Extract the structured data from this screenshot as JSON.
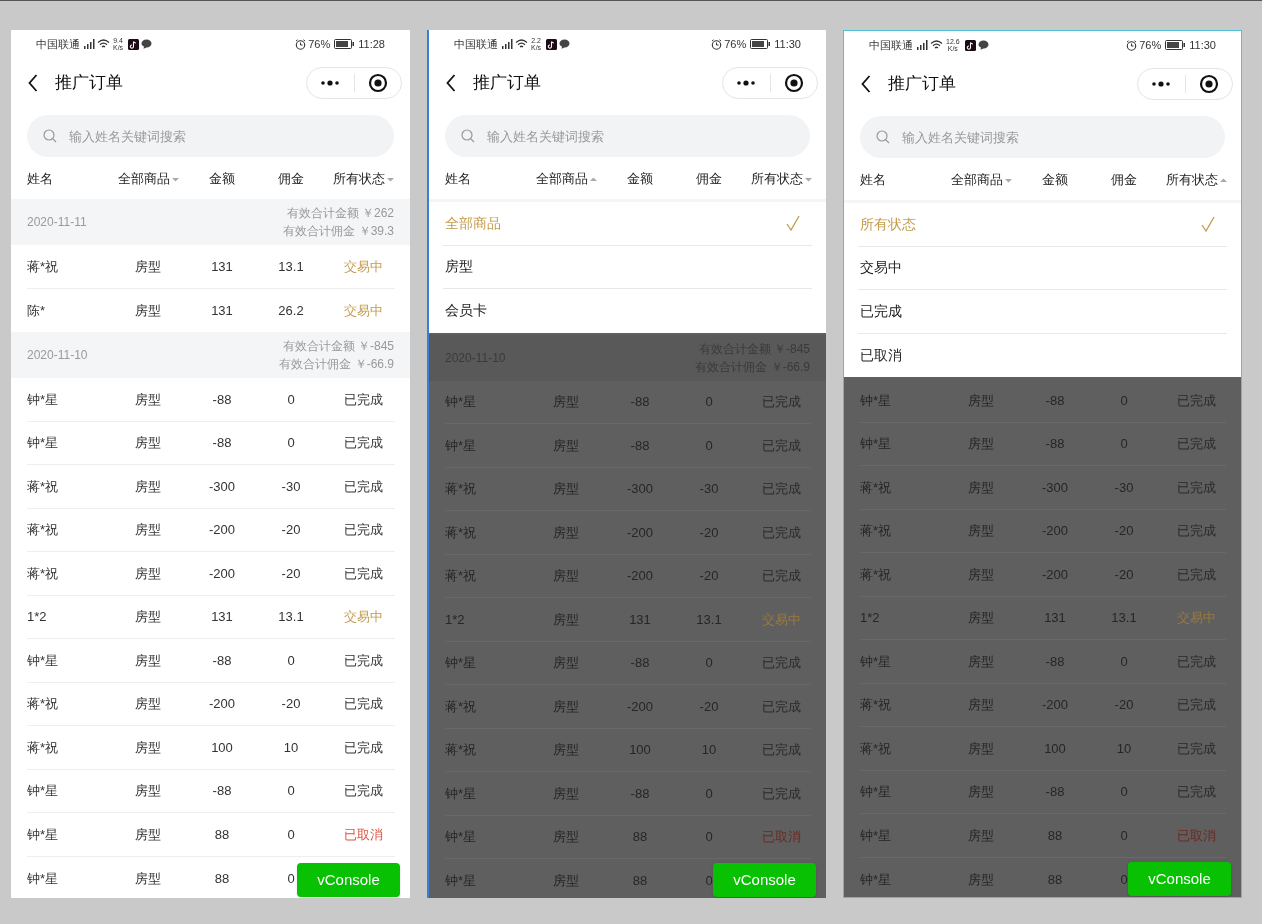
{
  "phones": [
    {
      "status_bar": {
        "carrier": "中国联通",
        "speed": "9.4",
        "speed_unit": "K/s",
        "battery": "76%",
        "time": "11:28"
      },
      "title": "推广订单",
      "search": {
        "placeholder": "输入姓名关键词搜索"
      },
      "columns": [
        {
          "label": "姓名",
          "kind": "label"
        },
        {
          "label": "全部商品",
          "kind": "filter",
          "expanded": false
        },
        {
          "label": "金额",
          "kind": "label"
        },
        {
          "label": "佣金",
          "kind": "label"
        },
        {
          "label": "所有状态",
          "kind": "filter",
          "expanded": false
        }
      ],
      "dimmed": false,
      "groups": [
        {
          "date": "2020-11-11",
          "total_amount": "有效合计金额 ￥262",
          "total_commission": "有效合计佣金 ￥39.3",
          "rows": [
            {
              "name": "蒋*祝",
              "product": "房型",
              "amount": "131",
              "commission": "13.1",
              "status": "交易中",
              "kind": "trading"
            },
            {
              "name": "陈*",
              "product": "房型",
              "amount": "131",
              "commission": "26.2",
              "status": "交易中",
              "kind": "trading"
            }
          ]
        },
        {
          "date": "2020-11-10",
          "total_amount": "有效合计金额 ￥-845",
          "total_commission": "有效合计佣金 ￥-66.9",
          "rows": [
            {
              "name": "钟*星",
              "product": "房型",
              "amount": "-88",
              "commission": "0",
              "status": "已完成",
              "kind": "done"
            },
            {
              "name": "钟*星",
              "product": "房型",
              "amount": "-88",
              "commission": "0",
              "status": "已完成",
              "kind": "done"
            },
            {
              "name": "蒋*祝",
              "product": "房型",
              "amount": "-300",
              "commission": "-30",
              "status": "已完成",
              "kind": "done"
            },
            {
              "name": "蒋*祝",
              "product": "房型",
              "amount": "-200",
              "commission": "-20",
              "status": "已完成",
              "kind": "done"
            },
            {
              "name": "蒋*祝",
              "product": "房型",
              "amount": "-200",
              "commission": "-20",
              "status": "已完成",
              "kind": "done"
            },
            {
              "name": "1*2",
              "product": "房型",
              "amount": "131",
              "commission": "13.1",
              "status": "交易中",
              "kind": "trading"
            },
            {
              "name": "钟*星",
              "product": "房型",
              "amount": "-88",
              "commission": "0",
              "status": "已完成",
              "kind": "done"
            },
            {
              "name": "蒋*祝",
              "product": "房型",
              "amount": "-200",
              "commission": "-20",
              "status": "已完成",
              "kind": "done"
            },
            {
              "name": "蒋*祝",
              "product": "房型",
              "amount": "100",
              "commission": "10",
              "status": "已完成",
              "kind": "done"
            },
            {
              "name": "钟*星",
              "product": "房型",
              "amount": "-88",
              "commission": "0",
              "status": "已完成",
              "kind": "done"
            },
            {
              "name": "钟*星",
              "product": "房型",
              "amount": "88",
              "commission": "0",
              "status": "已取消",
              "kind": "cancelled"
            },
            {
              "name": "钟*星",
              "product": "房型",
              "amount": "88",
              "commission": "0"
            }
          ]
        }
      ],
      "vconsole": "vConsole"
    },
    {
      "status_bar": {
        "carrier": "中国联通",
        "speed": "2.2",
        "speed_unit": "K/s",
        "battery": "76%",
        "time": "11:30"
      },
      "title": "推广订单",
      "search": {
        "placeholder": "输入姓名关键词搜索"
      },
      "columns": [
        {
          "label": "姓名",
          "kind": "label"
        },
        {
          "label": "全部商品",
          "kind": "filter",
          "expanded": true
        },
        {
          "label": "金额",
          "kind": "label"
        },
        {
          "label": "佣金",
          "kind": "label"
        },
        {
          "label": "所有状态",
          "kind": "filter",
          "expanded": false
        }
      ],
      "menu": {
        "options": [
          {
            "label": "全部商品",
            "selected": true
          },
          {
            "label": "房型",
            "selected": false
          },
          {
            "label": "会员卡",
            "selected": false
          }
        ]
      },
      "dimmed": true,
      "groups": [
        {
          "date": "2020-11-10",
          "total_amount": "有效合计金额 ￥-845",
          "total_commission": "有效合计佣金 ￥-66.9",
          "rows": [
            {
              "name": "钟*星",
              "product": "房型",
              "amount": "-88",
              "commission": "0",
              "status": "已完成",
              "kind": "done"
            },
            {
              "name": "钟*星",
              "product": "房型",
              "amount": "-88",
              "commission": "0",
              "status": "已完成",
              "kind": "done"
            },
            {
              "name": "蒋*祝",
              "product": "房型",
              "amount": "-300",
              "commission": "-30",
              "status": "已完成",
              "kind": "done"
            },
            {
              "name": "蒋*祝",
              "product": "房型",
              "amount": "-200",
              "commission": "-20",
              "status": "已完成",
              "kind": "done"
            },
            {
              "name": "蒋*祝",
              "product": "房型",
              "amount": "-200",
              "commission": "-20",
              "status": "已完成",
              "kind": "done"
            },
            {
              "name": "1*2",
              "product": "房型",
              "amount": "131",
              "commission": "13.1",
              "status": "交易中",
              "kind": "trading"
            },
            {
              "name": "钟*星",
              "product": "房型",
              "amount": "-88",
              "commission": "0",
              "status": "已完成",
              "kind": "done"
            },
            {
              "name": "蒋*祝",
              "product": "房型",
              "amount": "-200",
              "commission": "-20",
              "status": "已完成",
              "kind": "done"
            },
            {
              "name": "蒋*祝",
              "product": "房型",
              "amount": "100",
              "commission": "10",
              "status": "已完成",
              "kind": "done"
            },
            {
              "name": "钟*星",
              "product": "房型",
              "amount": "-88",
              "commission": "0",
              "status": "已完成",
              "kind": "done"
            },
            {
              "name": "钟*星",
              "product": "房型",
              "amount": "88",
              "commission": "0",
              "status": "已取消",
              "kind": "cancelled"
            },
            {
              "name": "钟*星",
              "product": "房型",
              "amount": "88",
              "commission": "0"
            }
          ]
        }
      ],
      "vconsole": "vConsole"
    },
    {
      "status_bar": {
        "carrier": "中国联通",
        "speed": "12.6",
        "speed_unit": "K/s",
        "battery": "76%",
        "time": "11:30"
      },
      "title": "推广订单",
      "search": {
        "placeholder": "输入姓名关键词搜索"
      },
      "columns": [
        {
          "label": "姓名",
          "kind": "label"
        },
        {
          "label": "全部商品",
          "kind": "filter",
          "expanded": false
        },
        {
          "label": "金额",
          "kind": "label"
        },
        {
          "label": "佣金",
          "kind": "label"
        },
        {
          "label": "所有状态",
          "kind": "filter",
          "expanded": true
        }
      ],
      "menu": {
        "options": [
          {
            "label": "所有状态",
            "selected": true
          },
          {
            "label": "交易中",
            "selected": false
          },
          {
            "label": "已完成",
            "selected": false
          },
          {
            "label": "已取消",
            "selected": false
          }
        ]
      },
      "dimmed": true,
      "groups": [
        {
          "rows": [
            {
              "name": "钟*星",
              "product": "房型",
              "amount": "-88",
              "commission": "0",
              "status": "已完成",
              "kind": "done"
            },
            {
              "name": "钟*星",
              "product": "房型",
              "amount": "-88",
              "commission": "0",
              "status": "已完成",
              "kind": "done"
            },
            {
              "name": "蒋*祝",
              "product": "房型",
              "amount": "-300",
              "commission": "-30",
              "status": "已完成",
              "kind": "done"
            },
            {
              "name": "蒋*祝",
              "product": "房型",
              "amount": "-200",
              "commission": "-20",
              "status": "已完成",
              "kind": "done"
            },
            {
              "name": "蒋*祝",
              "product": "房型",
              "amount": "-200",
              "commission": "-20",
              "status": "已完成",
              "kind": "done"
            },
            {
              "name": "1*2",
              "product": "房型",
              "amount": "131",
              "commission": "13.1",
              "status": "交易中",
              "kind": "trading"
            },
            {
              "name": "钟*星",
              "product": "房型",
              "amount": "-88",
              "commission": "0",
              "status": "已完成",
              "kind": "done"
            },
            {
              "name": "蒋*祝",
              "product": "房型",
              "amount": "-200",
              "commission": "-20",
              "status": "已完成",
              "kind": "done"
            },
            {
              "name": "蒋*祝",
              "product": "房型",
              "amount": "100",
              "commission": "10",
              "status": "已完成",
              "kind": "done"
            },
            {
              "name": "钟*星",
              "product": "房型",
              "amount": "-88",
              "commission": "0",
              "status": "已完成",
              "kind": "done"
            },
            {
              "name": "钟*星",
              "product": "房型",
              "amount": "88",
              "commission": "0",
              "status": "已取消",
              "kind": "cancelled"
            },
            {
              "name": "钟*星",
              "product": "房型",
              "amount": "88",
              "commission": "0"
            }
          ]
        }
      ],
      "vconsole": "vConsole"
    }
  ]
}
